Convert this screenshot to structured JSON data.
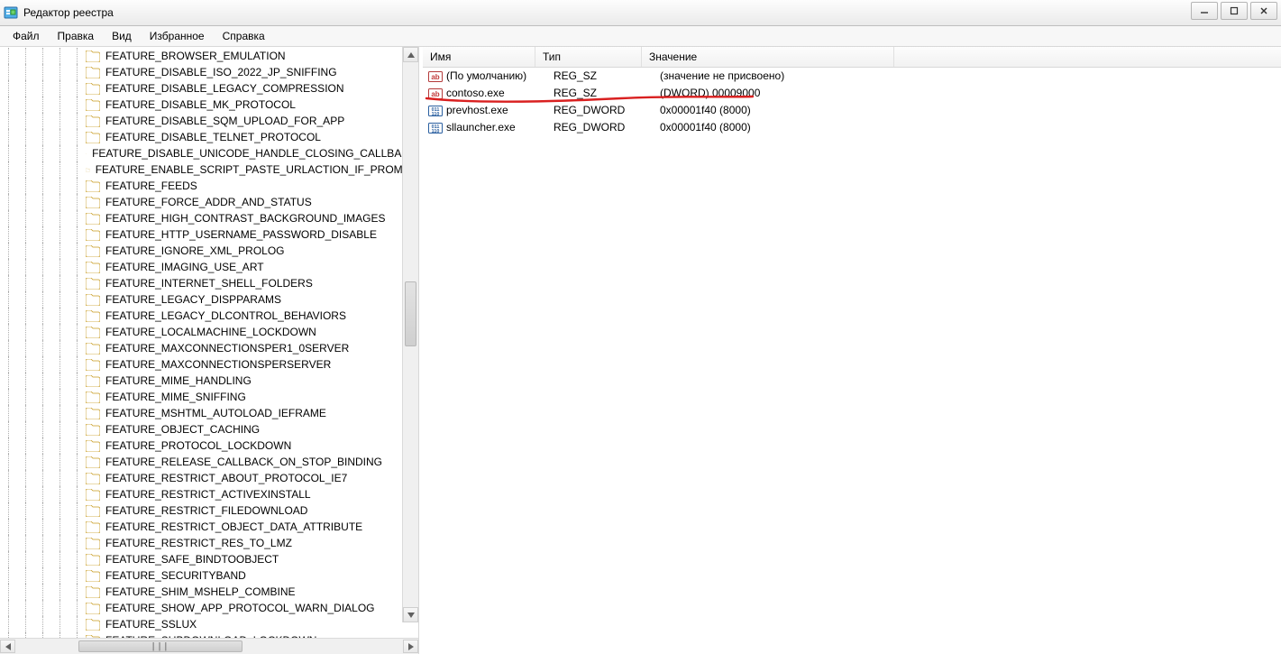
{
  "window": {
    "title": "Редактор реестра"
  },
  "menu": {
    "file": "Файл",
    "edit": "Правка",
    "view": "Вид",
    "favorites": "Избранное",
    "help": "Справка"
  },
  "tree": {
    "indent_depth": 5,
    "items": [
      {
        "label": "FEATURE_BROWSER_EMULATION"
      },
      {
        "label": "FEATURE_DISABLE_ISO_2022_JP_SNIFFING"
      },
      {
        "label": "FEATURE_DISABLE_LEGACY_COMPRESSION"
      },
      {
        "label": "FEATURE_DISABLE_MK_PROTOCOL"
      },
      {
        "label": "FEATURE_DISABLE_SQM_UPLOAD_FOR_APP"
      },
      {
        "label": "FEATURE_DISABLE_TELNET_PROTOCOL"
      },
      {
        "label": "FEATURE_DISABLE_UNICODE_HANDLE_CLOSING_CALLBACK"
      },
      {
        "label": "FEATURE_ENABLE_SCRIPT_PASTE_URLACTION_IF_PROMPT"
      },
      {
        "label": "FEATURE_FEEDS"
      },
      {
        "label": "FEATURE_FORCE_ADDR_AND_STATUS"
      },
      {
        "label": "FEATURE_HIGH_CONTRAST_BACKGROUND_IMAGES"
      },
      {
        "label": "FEATURE_HTTP_USERNAME_PASSWORD_DISABLE"
      },
      {
        "label": "FEATURE_IGNORE_XML_PROLOG"
      },
      {
        "label": "FEATURE_IMAGING_USE_ART"
      },
      {
        "label": "FEATURE_INTERNET_SHELL_FOLDERS"
      },
      {
        "label": "FEATURE_LEGACY_DISPPARAMS"
      },
      {
        "label": "FEATURE_LEGACY_DLCONTROL_BEHAVIORS"
      },
      {
        "label": "FEATURE_LOCALMACHINE_LOCKDOWN"
      },
      {
        "label": "FEATURE_MAXCONNECTIONSPER1_0SERVER"
      },
      {
        "label": "FEATURE_MAXCONNECTIONSPERSERVER"
      },
      {
        "label": "FEATURE_MIME_HANDLING"
      },
      {
        "label": "FEATURE_MIME_SNIFFING"
      },
      {
        "label": "FEATURE_MSHTML_AUTOLOAD_IEFRAME"
      },
      {
        "label": "FEATURE_OBJECT_CACHING"
      },
      {
        "label": "FEATURE_PROTOCOL_LOCKDOWN"
      },
      {
        "label": "FEATURE_RELEASE_CALLBACK_ON_STOP_BINDING"
      },
      {
        "label": "FEATURE_RESTRICT_ABOUT_PROTOCOL_IE7"
      },
      {
        "label": "FEATURE_RESTRICT_ACTIVEXINSTALL"
      },
      {
        "label": "FEATURE_RESTRICT_FILEDOWNLOAD"
      },
      {
        "label": "FEATURE_RESTRICT_OBJECT_DATA_ATTRIBUTE"
      },
      {
        "label": "FEATURE_RESTRICT_RES_TO_LMZ"
      },
      {
        "label": "FEATURE_SAFE_BINDTOOBJECT"
      },
      {
        "label": "FEATURE_SECURITYBAND"
      },
      {
        "label": "FEATURE_SHIM_MSHELP_COMBINE"
      },
      {
        "label": "FEATURE_SHOW_APP_PROTOCOL_WARN_DIALOG"
      },
      {
        "label": "FEATURE_SSLUX"
      },
      {
        "label": "FEATURE_SUBDOWNLOAD_LOCKDOWN"
      }
    ]
  },
  "list": {
    "columns": {
      "name": "Имя",
      "type": "Тип",
      "data": "Значение"
    },
    "rows": [
      {
        "icon": "sz",
        "name": "(По умолчанию)",
        "type": "REG_SZ",
        "data": "(значение не присвоено)",
        "annot": true
      },
      {
        "icon": "sz",
        "name": "contoso.exe",
        "type": "REG_SZ",
        "data": "(DWORD) 00009000",
        "annot": true
      },
      {
        "icon": "dw",
        "name": "prevhost.exe",
        "type": "REG_DWORD",
        "data": "0x00001f40 (8000)"
      },
      {
        "icon": "dw",
        "name": "sllauncher.exe",
        "type": "REG_DWORD",
        "data": "0x00001f40 (8000)"
      }
    ]
  }
}
